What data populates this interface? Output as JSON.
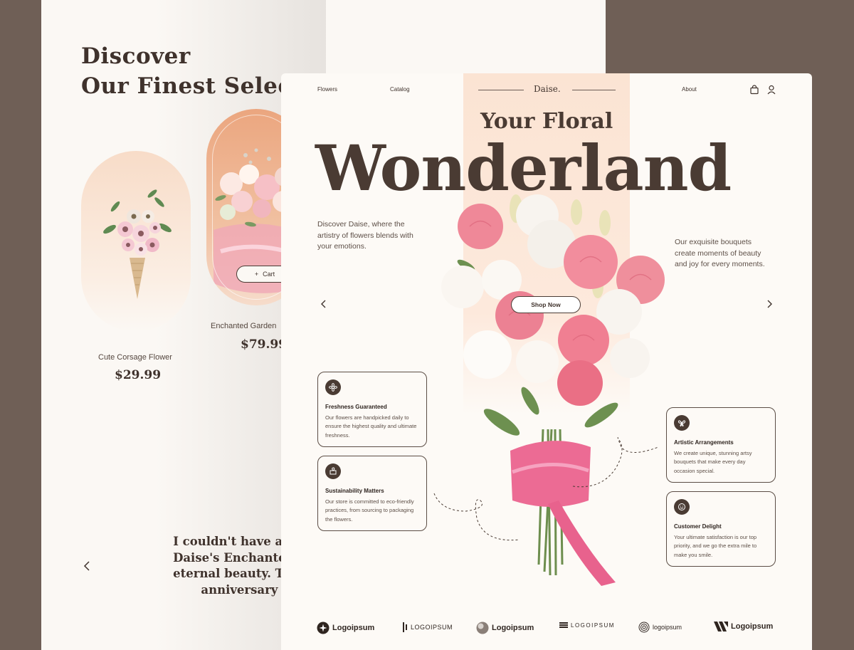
{
  "back_page": {
    "title_line1": "Discover",
    "title_line2": "Our Finest Selec",
    "products": [
      {
        "name": "Cute Corsage Flower",
        "price": "$29.99"
      },
      {
        "name": "Enchanted Garden",
        "price": "$79.99"
      }
    ],
    "cart_label": "Cart",
    "cart_prefix": "+",
    "quote_lines": [
      "I couldn't have asked f",
      "Daise's Enchanted Ros",
      "eternal beauty. Their a",
      "anniversary m"
    ]
  },
  "front_page": {
    "nav": {
      "flowers": "Flowers",
      "catalog": "Catalog",
      "brand": "Daise.",
      "about": "About"
    },
    "hero": {
      "subtitle": "Your Floral",
      "title": "Wonderland",
      "left_text": "Discover Daise, where the artistry of flowers blends with your emotions.",
      "right_text": "Our exquisite bouquets create moments of beauty and joy for every moments.",
      "cta": "Shop Now"
    },
    "features": [
      {
        "title": "Freshness Guaranteed",
        "desc": "Our flowers are handpicked daily to ensure the highest quality and ultimate freshness.",
        "icon": "flower-icon"
      },
      {
        "title": "Sustainability Matters",
        "desc": "Our store is committed to eco-friendly practices, from sourcing to packaging the flowers.",
        "icon": "leaf-box-icon"
      },
      {
        "title": "Artistic Arrangements",
        "desc": "We create unique, stunning artsy bouquets that make every day occasion special.",
        "icon": "butterfly-icon"
      },
      {
        "title": "Customer Delight",
        "desc": "Your ultimate satisfaction is our top priority, and we go the extra mile to make you smile.",
        "icon": "smile-badge-icon"
      }
    ],
    "logos": [
      "Logoipsum",
      "LOGOIPSUM",
      "Logoipsum",
      "LOGOIPSUM",
      "logoipsum",
      "Logoipsum"
    ]
  },
  "colors": {
    "brand_dark": "#4a3b33",
    "peach": "#fbe4d3",
    "background": "#6f5f56",
    "accent_pink": "#e86c86"
  }
}
